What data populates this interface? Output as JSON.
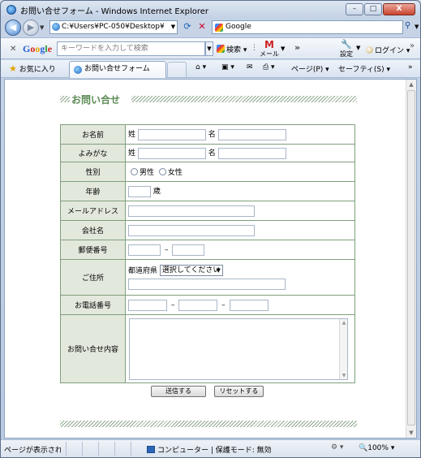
{
  "window": {
    "title": "お問い合せフォーム - Windows Internet Explorer",
    "buttons": {
      "minimize": "–",
      "maximize": "□",
      "close": "X"
    }
  },
  "address_bar": {
    "url": "C:¥Users¥PC-050¥Desktop¥",
    "search_provider": "Google"
  },
  "google_toolbar": {
    "search_placeholder": "キーワードを入力して検索",
    "search_button": "検索",
    "mail": "メール",
    "settings": "設定",
    "login": "ログイン"
  },
  "favorites_bar": {
    "favorites": "お気に入り",
    "tab_title": "お問い合せフォーム",
    "page_menu": "ページ(P)",
    "safety_menu": "セーフティ(S)"
  },
  "form": {
    "heading": "お問い合せ",
    "rows": {
      "name": {
        "label": "お名前",
        "last": "姓",
        "first": "名"
      },
      "kana": {
        "label": "よみがな",
        "last": "姓",
        "first": "名"
      },
      "gender": {
        "label": "性別",
        "male": "男性",
        "female": "女性"
      },
      "age": {
        "label": "年齢",
        "unit": "歳"
      },
      "email": {
        "label": "メールアドレス"
      },
      "company": {
        "label": "会社名"
      },
      "postal": {
        "label": "郵便番号",
        "dash": "–"
      },
      "address": {
        "label": "ご住所",
        "prefecture": "都道府県",
        "select_value": "選択してください"
      },
      "phone": {
        "label": "お電話番号",
        "dash1": "–",
        "dash2": "–"
      },
      "inquiry": {
        "label": "お問い合せ内容"
      }
    },
    "submit": "送信する",
    "reset": "リセットする"
  },
  "status_bar": {
    "status": "ページが表示されました",
    "zone": "コンピューター | 保護モード: 無効",
    "zoom": "100%"
  }
}
